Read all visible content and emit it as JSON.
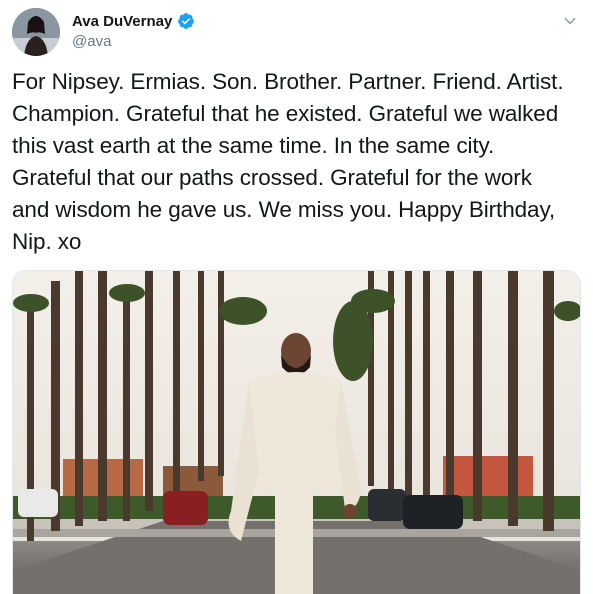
{
  "author": {
    "display_name": "Ava DuVernay",
    "handle": "@ava",
    "verified": true
  },
  "icons": {
    "verified": "verified-badge-icon",
    "caret": "chevron-down-icon"
  },
  "tweet": {
    "text_lines": [
      "For Nipsey. Ermias. Son. Brother. Partner. Friend. Artist.",
      "Champion. Grateful that he existed. Grateful we walked",
      "this vast earth at the same time. In the same city.",
      "Grateful that our paths crossed. Grateful for the work",
      "and wisdom he gave us. We miss you. Happy Birthday,",
      "Nip. xo"
    ]
  },
  "colors": {
    "verified": "#1da1f2",
    "text": "#14171a",
    "secondary": "#657786"
  }
}
